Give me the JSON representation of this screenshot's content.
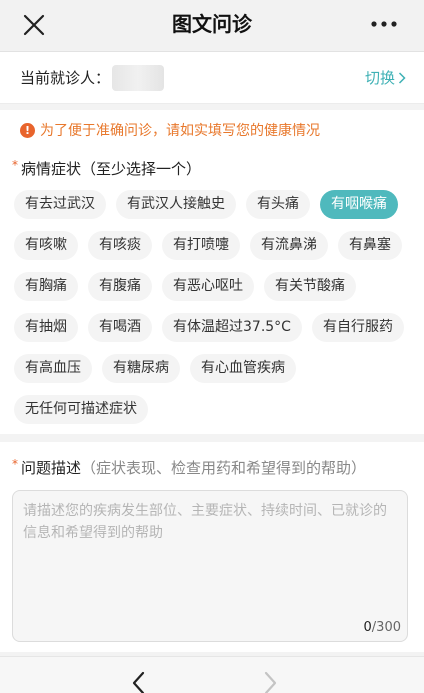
{
  "nav": {
    "title": "图文问诊",
    "close_icon": "close-icon",
    "more_icon": "more-icon"
  },
  "patient": {
    "label": "当前就诊人：",
    "switch_label": "切换",
    "switch_color": "#3fb1b5"
  },
  "notice": {
    "icon": "!",
    "text": "为了便于准确问诊，请如实填写您的健康情况",
    "color": "#e8782c"
  },
  "symptoms": {
    "required_mark": "*",
    "label": "病情症状（至少选择一个）",
    "selected_color": "#4fb9bd",
    "rows": [
      [
        {
          "label": "有去过武汉",
          "selected": false
        },
        {
          "label": "有武汉人接触史",
          "selected": false
        },
        {
          "label": "有头痛",
          "selected": false
        },
        {
          "label": "有咽喉痛",
          "selected": true
        }
      ],
      [
        {
          "label": "有咳嗽",
          "selected": false
        },
        {
          "label": "有咳痰",
          "selected": false
        },
        {
          "label": "有打喷嚏",
          "selected": false
        },
        {
          "label": "有流鼻涕",
          "selected": false
        },
        {
          "label": "有鼻塞",
          "selected": false
        }
      ],
      [
        {
          "label": "有胸痛",
          "selected": false
        },
        {
          "label": "有腹痛",
          "selected": false
        },
        {
          "label": "有恶心呕吐",
          "selected": false
        },
        {
          "label": "有关节酸痛",
          "selected": false
        }
      ],
      [
        {
          "label": "有抽烟",
          "selected": false
        },
        {
          "label": "有喝酒",
          "selected": false
        },
        {
          "label": "有体温超过37.5°C",
          "selected": false
        },
        {
          "label": "有自行服药",
          "selected": false
        }
      ],
      [
        {
          "label": "有高血压",
          "selected": false
        },
        {
          "label": "有糖尿病",
          "selected": false
        },
        {
          "label": "有心血管疾病",
          "selected": false
        }
      ],
      [
        {
          "label": "无任何可描述症状",
          "selected": false
        }
      ]
    ]
  },
  "description": {
    "required_mark": "*",
    "label": "问题描述",
    "hint": "（症状表现、检查用药和希望得到的帮助）",
    "placeholder": "请描述您的疾病发生部位、主要症状、持续时间、已就诊的信息和希望得到的帮助",
    "value": "",
    "count": "0",
    "max": "/300"
  },
  "bottom_nav": {
    "back_icon": "chevron-left-icon",
    "forward_icon": "chevron-right-icon"
  }
}
